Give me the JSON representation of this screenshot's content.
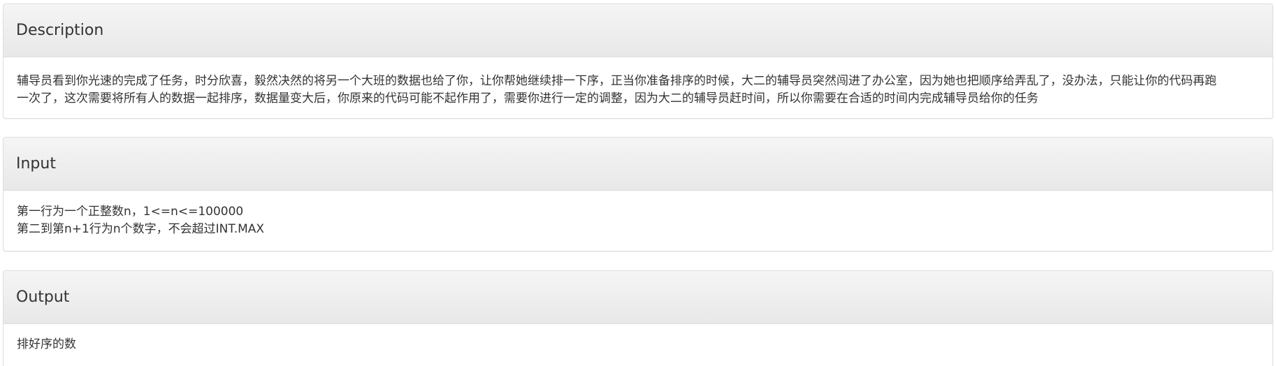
{
  "description": {
    "title": "Description",
    "lines": [
      "辅导员看到你光速的完成了任务，时分欣喜，毅然决然的将另一个大班的数据也给了你，让你帮她继续排一下序，正当你准备排序的时候，大二的辅导员突然闯进了办公室，因为她也把顺序给弄乱了，没办法，只能让你的代码再跑",
      "一次了，这次需要将所有人的数据一起排序，数据量变大后，你原来的代码可能不起作用了，需要你进行一定的调整，因为大二的辅导员赶时间，所以你需要在合适的时间内完成辅导员给你的任务"
    ]
  },
  "input": {
    "title": "Input",
    "lines": [
      "第一行为一个正整数n，1<=n<=100000",
      "第二到第n+1行为n个数字，不会超过INT.MAX"
    ]
  },
  "output": {
    "title": "Output",
    "lines": [
      "排好序的数"
    ]
  }
}
